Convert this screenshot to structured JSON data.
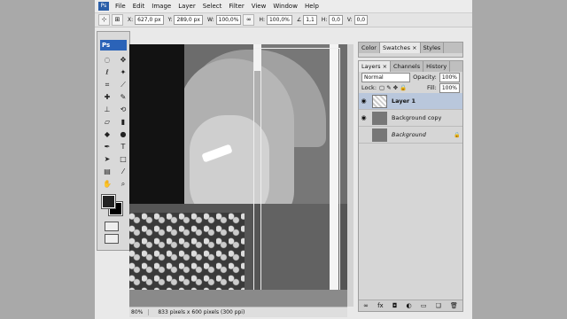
{
  "menubar": {
    "logo": "Ps",
    "items": [
      "File",
      "Edit",
      "Image",
      "Layer",
      "Select",
      "Filter",
      "View",
      "Window",
      "Help"
    ]
  },
  "optbar": {
    "x_label": "X:",
    "x_value": "627,0 px",
    "y_label": "Y:",
    "y_value": "289,0 px",
    "w_label": "W:",
    "w_value": "100,0%",
    "h_label": "H:",
    "h_value": "100,0%",
    "rot_value": "1,1",
    "hs_label": "H:",
    "hs_value": "0,0",
    "vs_label": "V:",
    "vs_value": "0,0"
  },
  "toolbox": {
    "title": "Ps"
  },
  "status": {
    "zoom": "80%",
    "info": "833 pixels x 600 pixels (300 ppi)"
  },
  "color_panel": {
    "tabs": [
      "Color",
      "Swatches ×",
      "Styles"
    ]
  },
  "layers_panel": {
    "tabs": [
      "Layers ×",
      "Channels",
      "History"
    ],
    "blend_mode": "Normal",
    "opacity_label": "Opacity:",
    "opacity_value": "100%",
    "lock_label": "Lock:",
    "fill_label": "Fill:",
    "fill_value": "100%",
    "layers": [
      {
        "name": "Layer 1"
      },
      {
        "name": "Background copy"
      },
      {
        "name": "Background"
      }
    ]
  },
  "colors": {
    "accent": "#2b63b8",
    "selection": "#b9c7dc"
  }
}
